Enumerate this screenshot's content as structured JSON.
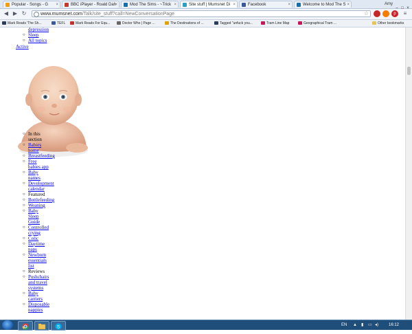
{
  "tabs": [
    {
      "label": "Popular - Songs - G",
      "icon_color": "#f39c12"
    },
    {
      "label": "BBC iPlayer - Roald Dah",
      "icon_color": "#c0392b"
    },
    {
      "label": "Mod The Sims - ~Trick",
      "icon_color": "#1a6ea8"
    },
    {
      "label": "Site stuff | Mumsnet Di",
      "icon_color": "#2b9ec2"
    },
    {
      "label": "Facebook",
      "icon_color": "#3b5998"
    },
    {
      "label": "Welcome to Mod The S",
      "icon_color": "#1a6ea8"
    }
  ],
  "user_name": "Amy",
  "address_bar": {
    "domain": "www.mumsnet.com",
    "path": "/Talk/site_stuff?call=NewConversationPage"
  },
  "bookmarks": [
    {
      "label": "Mark Reads 'The Sh...",
      "icon_color": "#2d3d55"
    },
    {
      "label": "TEFL",
      "icon_color": "#3b5998"
    },
    {
      "label": "Mark Reads For Equ...",
      "icon_color": "#c4302b"
    },
    {
      "label": "Doctor Who | Page ...",
      "icon_color": "#666666"
    },
    {
      "label": "The Destinations of ...",
      "icon_color": "#e1a100"
    },
    {
      "label": "Tagged \"unfuck you...",
      "icon_color": "#2d3d55"
    },
    {
      "label": "Tram Line Map",
      "icon_color": "#c2185b"
    },
    {
      "label": "Geographical Tram ...",
      "icon_color": "#c2185b"
    },
    {
      "label": "Other bookmarks",
      "icon_color": "#e8c35a"
    }
  ],
  "top_list": [
    "depression",
    "Sleep",
    "All topics"
  ],
  "active_label": "Active",
  "section_list": [
    {
      "lines": [
        "In this",
        "section"
      ],
      "link": false
    },
    {
      "lines": [
        "Babies",
        "home"
      ],
      "link": true
    },
    {
      "lines": [
        "Breastfeeding"
      ],
      "link": true
    },
    {
      "lines": [
        "Free",
        "babies app"
      ],
      "link": true
    },
    {
      "lines": [
        "Baby",
        "names"
      ],
      "link": true
    },
    {
      "lines": [
        "Development",
        "calendar"
      ],
      "link": true
    },
    {
      "lines": [
        "Featured"
      ],
      "link": false
    },
    {
      "lines": [
        "Bottlefeeding"
      ],
      "link": true
    },
    {
      "lines": [
        "Weaning"
      ],
      "link": true
    },
    {
      "lines": [
        "Baby",
        "Sleep",
        "Guide"
      ],
      "link": true
    },
    {
      "lines": [
        "Controlled",
        "crying"
      ],
      "link": true
    },
    {
      "lines": [
        "Colic"
      ],
      "link": true
    },
    {
      "lines": [
        "Daytime",
        "naps"
      ],
      "link": true
    },
    {
      "lines": [
        "Newborn",
        "essentials",
        "list"
      ],
      "link": true
    },
    {
      "lines": [
        "Reviews"
      ],
      "link": false
    },
    {
      "lines": [
        "Pushchairs",
        "and travel",
        "systems"
      ],
      "link": true
    },
    {
      "lines": [
        "Baby",
        "carriers"
      ],
      "link": true
    },
    {
      "lines": [
        "Disposable",
        "nappies"
      ],
      "link": true
    }
  ],
  "taskbar": {
    "language": "EN",
    "clock": "16:12"
  }
}
